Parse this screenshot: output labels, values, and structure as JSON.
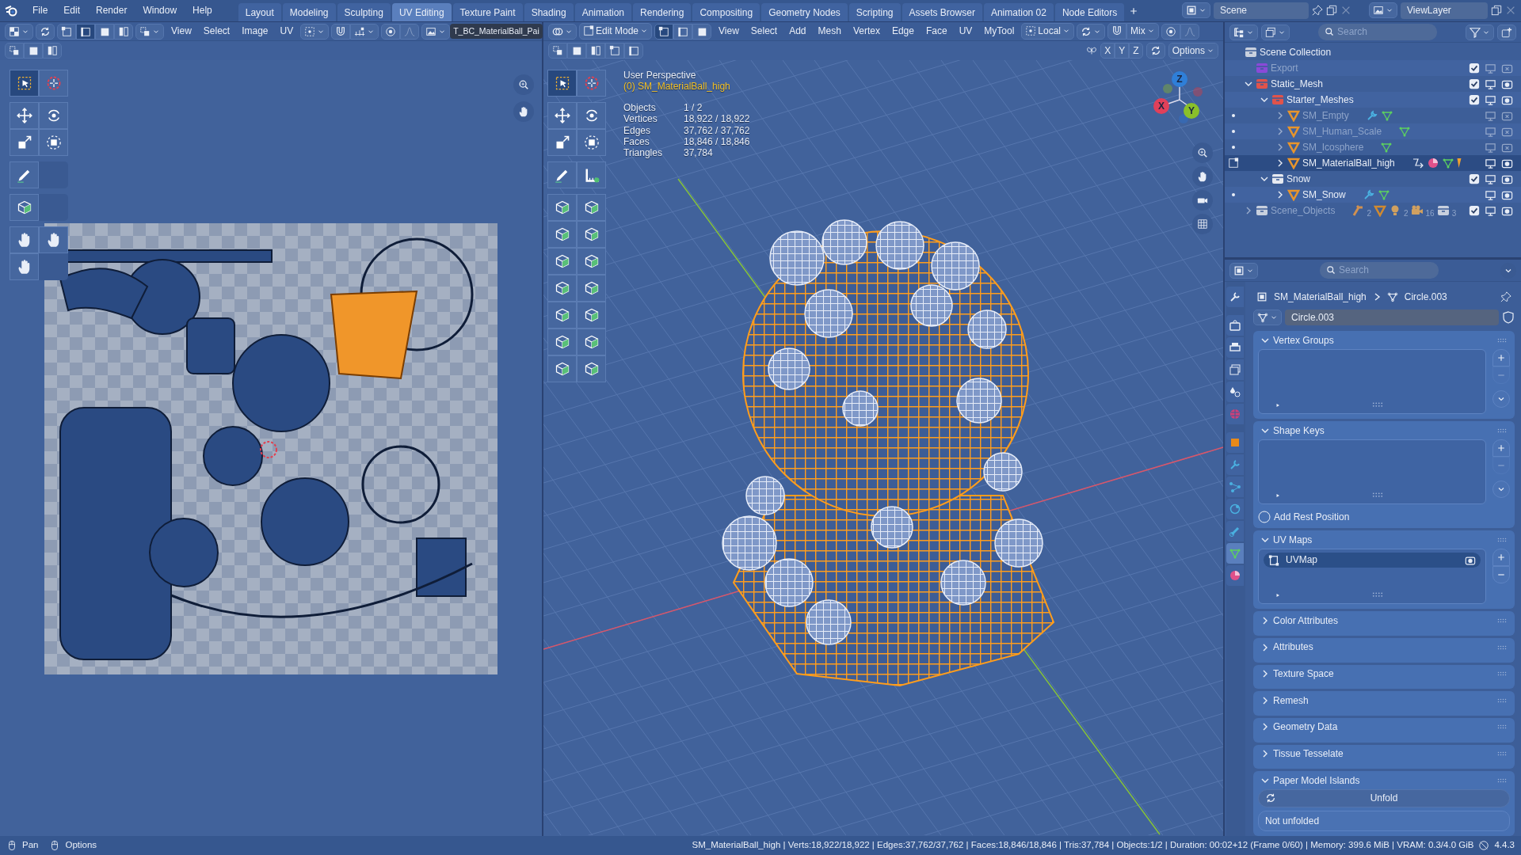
{
  "menu": [
    "File",
    "Edit",
    "Render",
    "Window",
    "Help"
  ],
  "workspaces": [
    {
      "label": "Layout",
      "selected": false
    },
    {
      "label": "Modeling",
      "selected": false
    },
    {
      "label": "Sculpting",
      "selected": false
    },
    {
      "label": "UV Editing",
      "selected": true
    },
    {
      "label": "Texture Paint",
      "selected": false
    },
    {
      "label": "Shading",
      "selected": false
    },
    {
      "label": "Animation",
      "selected": false
    },
    {
      "label": "Rendering",
      "selected": false
    },
    {
      "label": "Compositing",
      "selected": false
    },
    {
      "label": "Geometry Nodes",
      "selected": false
    },
    {
      "label": "Scripting",
      "selected": false
    },
    {
      "label": "Assets Browser",
      "selected": false
    },
    {
      "label": "Animation 02",
      "selected": false
    },
    {
      "label": "Node Editors",
      "selected": false
    }
  ],
  "scene": "Scene",
  "view_layer": "ViewLayer",
  "uv_editor": {
    "menus": [
      "View",
      "Select",
      "Image",
      "UV"
    ],
    "image": "T_BC_MaterialBall_Pai",
    "tools": [
      [
        {
          "kind": "select",
          "selected": true
        },
        {
          "kind": "cursor",
          "selected": false
        }
      ],
      [
        {
          "kind": "move",
          "selected": false
        },
        {
          "kind": "rotate",
          "selected": false
        },
        {
          "kind": "scale",
          "selected": false
        },
        {
          "kind": "transform",
          "selected": false
        }
      ],
      [
        {
          "kind": "annotate",
          "selected": false
        }
      ],
      [
        {
          "kind": "rip",
          "selected": false
        }
      ],
      [
        {
          "kind": "grab",
          "selected": false
        },
        {
          "kind": "pinch",
          "selected": false
        },
        {
          "kind": "relax",
          "selected": false
        }
      ]
    ]
  },
  "viewport": {
    "mode": "Edit Mode",
    "menus": [
      "View",
      "Select",
      "Add",
      "Mesh",
      "Vertex",
      "Edge",
      "Face",
      "UV",
      "MyTool"
    ],
    "pivot": "Local",
    "snap": "Mix",
    "mirror_axes": [
      "X",
      "Y",
      "Z"
    ],
    "options": "Options",
    "perspective": "User Perspective",
    "active_object": "(0) SM_MaterialBall_high",
    "stats": [
      {
        "label": "Objects",
        "value": "1 / 2"
      },
      {
        "label": "Vertices",
        "value": "18,922 / 18,922"
      },
      {
        "label": "Edges",
        "value": "37,762 / 37,762"
      },
      {
        "label": "Faces",
        "value": "18,846 / 18,846"
      },
      {
        "label": "Triangles",
        "value": "37,784"
      }
    ],
    "gizmo": [
      {
        "label": "Z",
        "color": "#2f7fd8"
      },
      {
        "label": "X",
        "color": "#e0405a"
      },
      {
        "label": "Y",
        "color": "#8ac02a"
      }
    ],
    "tools": [
      [
        {
          "kind": "select",
          "selected": true
        },
        {
          "kind": "cursor",
          "selected": false
        }
      ],
      [
        {
          "kind": "move",
          "selected": false
        },
        {
          "kind": "rotate",
          "selected": false
        },
        {
          "kind": "scale",
          "selected": false
        },
        {
          "kind": "transform",
          "selected": false
        }
      ],
      [
        {
          "kind": "annotate",
          "selected": false
        },
        {
          "kind": "measure",
          "selected": false
        }
      ],
      [
        {
          "kind": "add_cube",
          "selected": false
        },
        {
          "kind": "extrude",
          "selected": false
        },
        {
          "kind": "inset",
          "selected": false
        },
        {
          "kind": "bevel",
          "selected": false
        },
        {
          "kind": "loop_cut",
          "selected": false
        },
        {
          "kind": "knife",
          "selected": false
        },
        {
          "kind": "poly_build",
          "selected": false
        },
        {
          "kind": "spin",
          "selected": false
        },
        {
          "kind": "smooth",
          "selected": false
        },
        {
          "kind": "randomize",
          "selected": false
        },
        {
          "kind": "edge_slide",
          "selected": false
        },
        {
          "kind": "shrink",
          "selected": false
        },
        {
          "kind": "shear",
          "selected": false
        },
        {
          "kind": "rip",
          "selected": false
        }
      ]
    ]
  },
  "outliner": {
    "search_placeholder": "Search",
    "root": "Scene Collection",
    "items": [
      {
        "name": "Export",
        "kind": "collection",
        "color": "#8a4ad8",
        "checked": true,
        "greyed": true,
        "render_off": true,
        "selected": false
      },
      {
        "name": "Static_Mesh",
        "kind": "collection",
        "color": "#e0534b",
        "expanded": true,
        "checked": true,
        "greyed": false,
        "render_off": false,
        "selected": false,
        "children": [
          {
            "name": "Starter_Meshes",
            "kind": "collection",
            "color": "#e0534b",
            "expanded": true,
            "checked": true,
            "greyed": false,
            "render_off": false,
            "selected": false,
            "children": [
              {
                "name": "SM_Empty",
                "kind": "object",
                "expanded": false,
                "greyed": true,
                "render_off": true,
                "selected": false,
                "badges": [
                  {
                    "kind": "modifier"
                  },
                  {
                    "kind": "mesh"
                  }
                ]
              },
              {
                "name": "SM_Human_Scale",
                "kind": "object",
                "expanded": false,
                "greyed": true,
                "render_off": true,
                "selected": false,
                "badges": [
                  {
                    "kind": "mesh"
                  }
                ]
              },
              {
                "name": "SM_Icosphere",
                "kind": "object",
                "expanded": false,
                "greyed": true,
                "render_off": true,
                "selected": false,
                "badges": [
                  {
                    "kind": "mesh"
                  }
                ]
              },
              {
                "name": "SM_MaterialBall_high",
                "kind": "object",
                "expanded": false,
                "greyed": false,
                "render_off": false,
                "selected": true,
                "badges": [
                  {
                    "kind": "hook"
                  },
                  {
                    "kind": "material"
                  },
                  {
                    "kind": "mesh"
                  },
                  {
                    "kind": "brush"
                  }
                ]
              }
            ]
          },
          {
            "name": "Snow",
            "kind": "collection",
            "color": "#e6e9f0",
            "expanded": true,
            "checked": true,
            "greyed": false,
            "render_off": false,
            "selected": false,
            "children": [
              {
                "name": "SM_Snow",
                "kind": "object",
                "expanded": false,
                "greyed": false,
                "render_off": false,
                "selected": false,
                "badges": [
                  {
                    "kind": "modifier"
                  },
                  {
                    "kind": "mesh"
                  }
                ]
              }
            ]
          }
        ]
      },
      {
        "name": "Scene_Objects",
        "kind": "collection",
        "color": "#c8d0de",
        "expanded": false,
        "checked": true,
        "greyed": true,
        "render_off": false,
        "selected": false,
        "contents": [
          {
            "kind": "bone",
            "count": "2"
          },
          {
            "kind": "object"
          },
          {
            "kind": "light",
            "count": "2"
          },
          {
            "kind": "camera",
            "count": "16"
          },
          {
            "kind": "collection",
            "count": "3"
          }
        ]
      }
    ]
  },
  "properties": {
    "search_placeholder": "Search",
    "tabs": [
      {
        "kind": "tool",
        "selected": false
      },
      {
        "kind": "render",
        "selected": false
      },
      {
        "kind": "output",
        "selected": false
      },
      {
        "kind": "view_layer",
        "selected": false
      },
      {
        "kind": "scene",
        "selected": false
      },
      {
        "kind": "world",
        "selected": false
      },
      {
        "kind": "object",
        "selected": false
      },
      {
        "kind": "modifier",
        "selected": false
      },
      {
        "kind": "particles",
        "selected": false
      },
      {
        "kind": "physics",
        "selected": false
      },
      {
        "kind": "constraints",
        "selected": false
      },
      {
        "kind": "data",
        "selected": true
      },
      {
        "kind": "material",
        "selected": false
      }
    ],
    "breadcrumb": [
      "SM_MaterialBall_high",
      "Circle.003"
    ],
    "mesh_name": "Circle.003",
    "panels": [
      {
        "title": "Vertex Groups",
        "kind": "list",
        "expanded": true
      },
      {
        "title": "Shape Keys",
        "kind": "list",
        "expanded": true,
        "option": {
          "label": "Add Rest Position",
          "checked": false
        }
      },
      {
        "title": "UV Maps",
        "kind": "list",
        "expanded": true,
        "items": [
          {
            "label": "UVMap",
            "selected": true
          }
        ]
      },
      {
        "title": "Color Attributes",
        "expanded": false
      },
      {
        "title": "Attributes",
        "expanded": false
      },
      {
        "title": "Texture Space",
        "expanded": false
      },
      {
        "title": "Remesh",
        "expanded": false
      },
      {
        "title": "Geometry Data",
        "expanded": false
      },
      {
        "title": "Tissue Tesselate",
        "expanded": false
      },
      {
        "title": "Paper Model Islands",
        "kind": "unfold",
        "expanded": true,
        "button": "Unfold",
        "status": "Not unfolded"
      }
    ]
  },
  "status_bar": {
    "hints": [
      "Pan",
      "Options"
    ],
    "stats": "SM_MaterialBall_high | Verts:18,922/18,922 | Edges:37,762/37,762 | Faces:18,846/18,846 | Tris:37,784 | Objects:1/2 | Duration: 00:02+12 (Frame 0/60) | Memory: 399.6 MiB | VRAM: 0.3/4.0 GiB",
    "version": "4.4.3"
  }
}
